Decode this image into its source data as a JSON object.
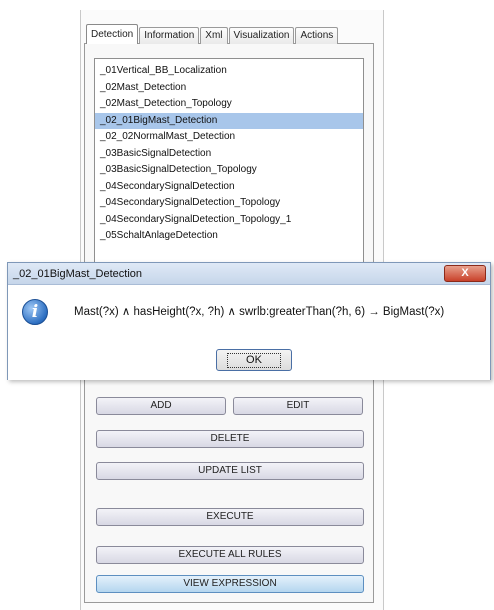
{
  "tabs": [
    "Detection",
    "Information",
    "Xml",
    "Visualization",
    "Actions"
  ],
  "active_tab": 0,
  "rules": [
    "_01Vertical_BB_Localization",
    "_02Mast_Detection",
    "_02Mast_Detection_Topology",
    "_02_01BigMast_Detection",
    "_02_02NormalMast_Detection",
    "_03BasicSignalDetection",
    "_03BasicSignalDetection_Topology",
    "_04SecondarySignalDetection",
    "_04SecondarySignalDetection_Topology",
    "_04SecondarySignalDetection_Topology_1",
    "_05SchaltAnlageDetection"
  ],
  "selected_rule": 3,
  "dialog": {
    "title": "_02_01BigMast_Detection",
    "close_label": "X",
    "icon": "info-icon",
    "message": "Mast(?x) ∧ hasHeight(?x, ?h) ∧ swrlb:greaterThan(?h, 6) → BigMast(?x)",
    "ok_label": "OK"
  },
  "buttons": {
    "add": "ADD",
    "edit": "EDIT",
    "delete": "DELETE",
    "update_list": "UPDATE LIST",
    "execute": "EXECUTE",
    "execute_all": "EXECUTE ALL RULES",
    "view_expression": "VIEW EXPRESSION"
  },
  "colors": {
    "selection": "#a8c6ea",
    "dialog_title": "#c6d6ea",
    "close_button": "#c8412a",
    "highlight_button": "#b4d6ef"
  }
}
